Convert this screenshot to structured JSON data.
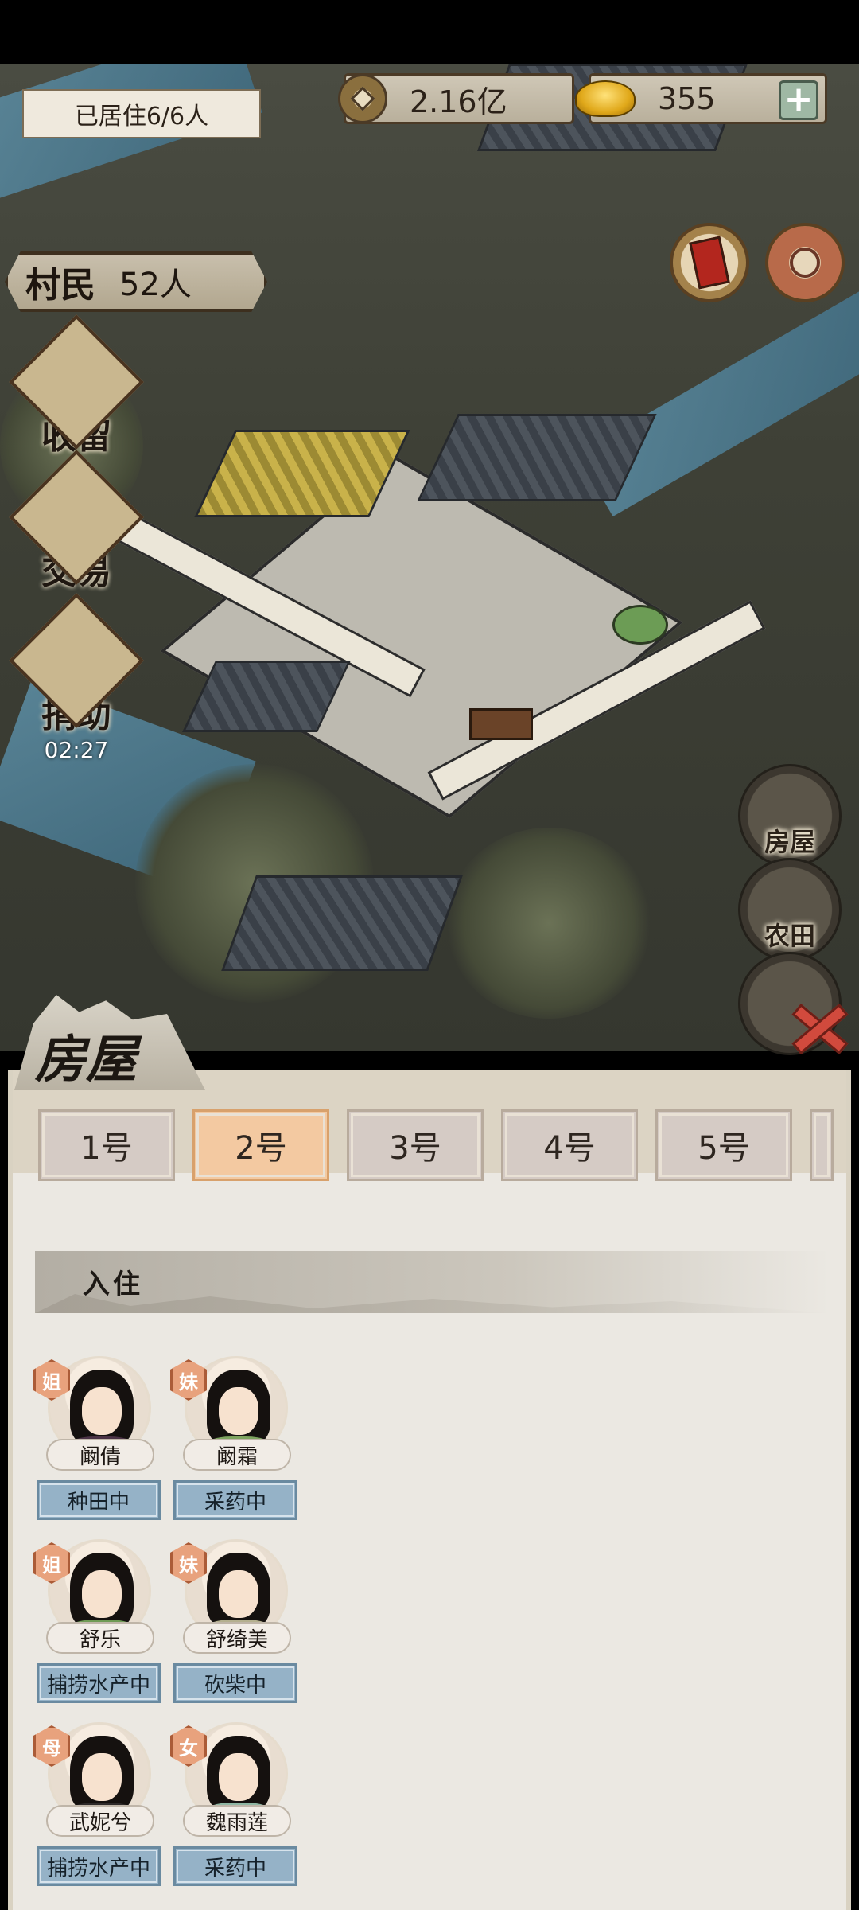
{
  "hud": {
    "residents_text": "已居住6/6人",
    "coins": "2.16亿",
    "ingots": "355",
    "villagers_label": "村民",
    "villagers_count": "52人"
  },
  "side_menu": [
    {
      "label": "收留",
      "timer": ""
    },
    {
      "label": "交易",
      "timer": ""
    },
    {
      "label": "捐助",
      "timer": "02:27"
    }
  ],
  "category_buttons": [
    "房屋",
    "农田",
    ""
  ],
  "panel": {
    "title": "房屋",
    "tabs": [
      "1号",
      "2号",
      "3号",
      "4号",
      "5号"
    ],
    "active_tab": 1,
    "section_title": "入住",
    "residents": [
      {
        "relation": "姐",
        "name": "阚倩",
        "job": "种田中",
        "robe": "#4b3346"
      },
      {
        "relation": "妹",
        "name": "阚霜",
        "job": "采药中",
        "robe": "#7da35f"
      },
      {
        "relation": "姐",
        "name": "舒乐",
        "job": "捕捞水产中",
        "robe": "#6f9b55"
      },
      {
        "relation": "妹",
        "name": "舒绮美",
        "job": "砍柴中",
        "robe": "#b4b08f"
      },
      {
        "relation": "母",
        "name": "武妮兮",
        "job": "捕捞水产中",
        "robe": "#2e2a2a"
      },
      {
        "relation": "女",
        "name": "魏雨莲",
        "job": "采药中",
        "robe": "#8fb7a4"
      }
    ]
  },
  "colors": {
    "active_tab": "#f3c9a1",
    "job_badge": "#95b2c7",
    "relation_badge": "#e8a27d",
    "close_x": "#d14a3d"
  }
}
